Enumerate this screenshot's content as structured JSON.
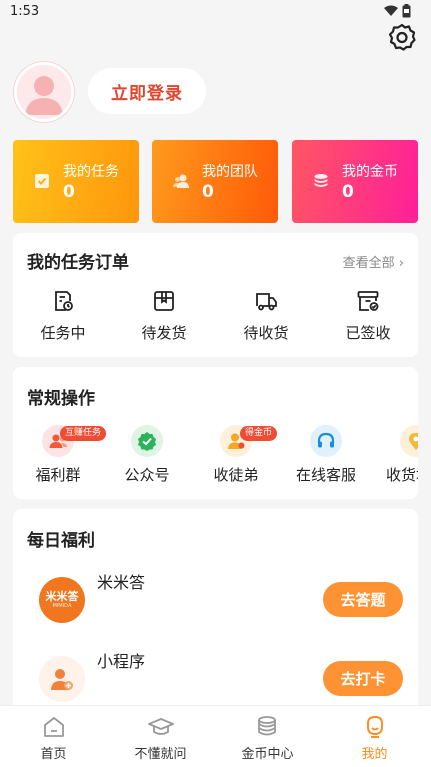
{
  "status_bar": {
    "time": "1:53"
  },
  "profile": {
    "login_label": "立即登录"
  },
  "stats": [
    {
      "label": "我的任务",
      "value": "0",
      "icon": "task-check-icon"
    },
    {
      "label": "我的团队",
      "value": "0",
      "icon": "team-icon"
    },
    {
      "label": "我的金币",
      "value": "0",
      "icon": "coins-icon"
    }
  ],
  "orders": {
    "title": "我的任务订单",
    "view_all": "查看全部 ›",
    "items": [
      {
        "label": "任务中",
        "icon": "in-progress-icon"
      },
      {
        "label": "待发货",
        "icon": "package-icon"
      },
      {
        "label": "待收货",
        "icon": "truck-icon"
      },
      {
        "label": "已签收",
        "icon": "signed-box-icon"
      }
    ]
  },
  "operations": {
    "title": "常规操作",
    "items": [
      {
        "label": "福利群",
        "tag": "互赚任务",
        "icon": "group-icon"
      },
      {
        "label": "公众号",
        "tag": "",
        "icon": "verified-icon"
      },
      {
        "label": "收徒弟",
        "tag": "得金币",
        "icon": "apprentice-icon"
      },
      {
        "label": "在线客服",
        "tag": "",
        "icon": "headset-icon"
      },
      {
        "label": "收货地址",
        "tag": "",
        "icon": "location-icon"
      }
    ]
  },
  "welfare": {
    "title": "每日福利",
    "items": [
      {
        "name": "米米答",
        "logo_text": "米米答",
        "logo_sub": "MIMIDA",
        "button": "去答题"
      },
      {
        "name": "小程序",
        "button": "去打卡"
      }
    ]
  },
  "tabs": [
    {
      "label": "首页",
      "icon": "home-icon"
    },
    {
      "label": "不懂就问",
      "icon": "graduation-cap-icon"
    },
    {
      "label": "金币中心",
      "icon": "coin-stack-icon"
    },
    {
      "label": "我的",
      "icon": "profile-face-icon"
    }
  ],
  "colors": {
    "accent": "#ff8a1e",
    "login_text": "#e0462f",
    "card1": "#ffa010",
    "card2": "#ff6d10",
    "card3": "#ff3a7a",
    "button": "#ff9233"
  }
}
